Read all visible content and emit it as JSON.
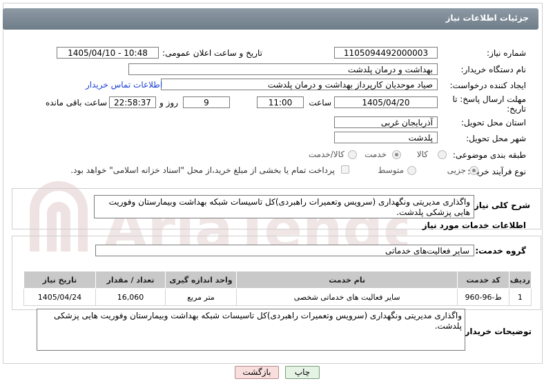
{
  "header": {
    "title": "جزئیات اطلاعات نیاز"
  },
  "form": {
    "need_number_label": "شماره نیاز:",
    "need_number": "1105094492000003",
    "announce_label": "تاریخ و ساعت اعلان عمومی:",
    "announce_value": "1405/04/10 - 10:48",
    "buyer_org_label": "نام دستگاه خریدار:",
    "buyer_org": "بهداشت و درمان پلدشت",
    "requester_label": "ایجاد کننده درخواست:",
    "requester": "صیاد موحدیان کارپرداز بهداشت و درمان پلدشت",
    "contact_link": "اطلاعات تماس خریدار",
    "deadline_label_1": "مهلت ارسال پاسخ: تا",
    "deadline_label_2": "تاریخ:",
    "deadline_date": "1405/04/20",
    "time_label": "ساعت",
    "deadline_time": "11:00",
    "days_value": "9",
    "days_label": "روز و",
    "remaining_time": "22:58:37",
    "remaining_label": "ساعت باقی مانده",
    "province_label": "استان محل تحویل:",
    "province": "آذربایجان غربی",
    "city_label": "شهر محل تحویل:",
    "city": "پلدشت",
    "category_label": "طبقه بندی موضوعی:",
    "category_options": [
      "کالا",
      "خدمت",
      "کالا/خدمت"
    ],
    "process_label": "نوع فرآیند خرید :",
    "process_options": [
      "جزیی",
      "متوسط"
    ],
    "payment_note": "پرداخت تمام یا بخشی از مبلغ خرید،از محل \"اسناد خزانه اسلامی\" خواهد بود."
  },
  "description": {
    "label": "شرح کلی نیاز:",
    "text": "واگذاری مدیریتی ونگهداری (سرویس وتعمیرات راهبردی)کل تاسیسات شبکه بهداشت وبیمارستان وفوریت هایی پزشکی پلدشت."
  },
  "services": {
    "section_title": "اطلاعات خدمات مورد نیاز",
    "group_label": "گروه خدمت:",
    "group_value": "سایر فعالیت‌های خدماتی",
    "columns": [
      "ردیف",
      "کد خدمت",
      "نام خدمت",
      "واحد اندازه گیری",
      "تعداد / مقدار",
      "تاریخ نیاز"
    ],
    "rows": [
      {
        "row": "1",
        "code": "ط-96-960",
        "name": "سایر فعالیت های خدماتی شخصی",
        "unit": "متر مربع",
        "qty": "16,060",
        "date": "1405/04/24"
      }
    ]
  },
  "buyer_notes": {
    "label": "توضیحات خریدار:",
    "text": "واگذاری مدیریتی ونگهداری (سرویس وتعمیرات راهبردی)کل تاسیسات شبکه بهداشت وبیمارستان وفوریت هایی پزشکی پلدشت."
  },
  "buttons": {
    "print": "چاپ",
    "back": "بازگشت"
  },
  "watermark": "AriaTender.net",
  "colors": {
    "header": "#7c8995",
    "link": "#1a3fd6",
    "back_button_bg": "#f9dede",
    "print_button_bg": "#e4f3e4"
  }
}
